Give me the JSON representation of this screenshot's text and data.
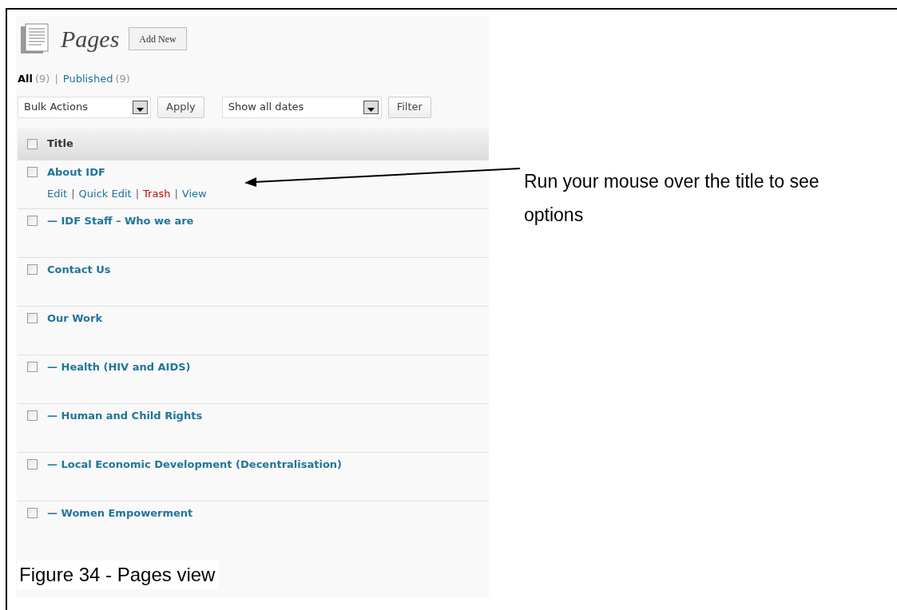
{
  "heading": {
    "title": "Pages",
    "add_button": "Add New"
  },
  "views": [
    {
      "label": "All",
      "count": "(9)",
      "selected": true
    },
    {
      "label": "Published",
      "count": "(9)",
      "selected": false
    }
  ],
  "view_separator": "|",
  "toolbar": {
    "bulk_select": "Bulk Actions",
    "apply_button": "Apply",
    "date_select": "Show all dates",
    "filter_button": "Filter"
  },
  "table": {
    "column_header": "Title",
    "header_checked": false,
    "rows": [
      {
        "title": "About IDF",
        "checked": false,
        "actions": [
          {
            "label": "Edit",
            "kind": "link"
          },
          {
            "label": "Quick Edit",
            "kind": "link"
          },
          {
            "label": "Trash",
            "kind": "delete"
          },
          {
            "label": "View",
            "kind": "link"
          }
        ]
      },
      {
        "title": "— IDF Staff – Who we are",
        "checked": false
      },
      {
        "title": "Contact Us",
        "checked": false
      },
      {
        "title": "Our Work",
        "checked": false
      },
      {
        "title": "— Health (HIV and AIDS)",
        "checked": false
      },
      {
        "title": "— Human and Child Rights",
        "checked": false
      },
      {
        "title": "— Local Economic Development (Decentralisation)",
        "checked": false
      },
      {
        "title": "— Women Empowerment",
        "checked": false
      }
    ]
  },
  "action_separator": "|",
  "caption": "Figure 34 - Pages view",
  "callout": "Run your mouse over the title to see options"
}
